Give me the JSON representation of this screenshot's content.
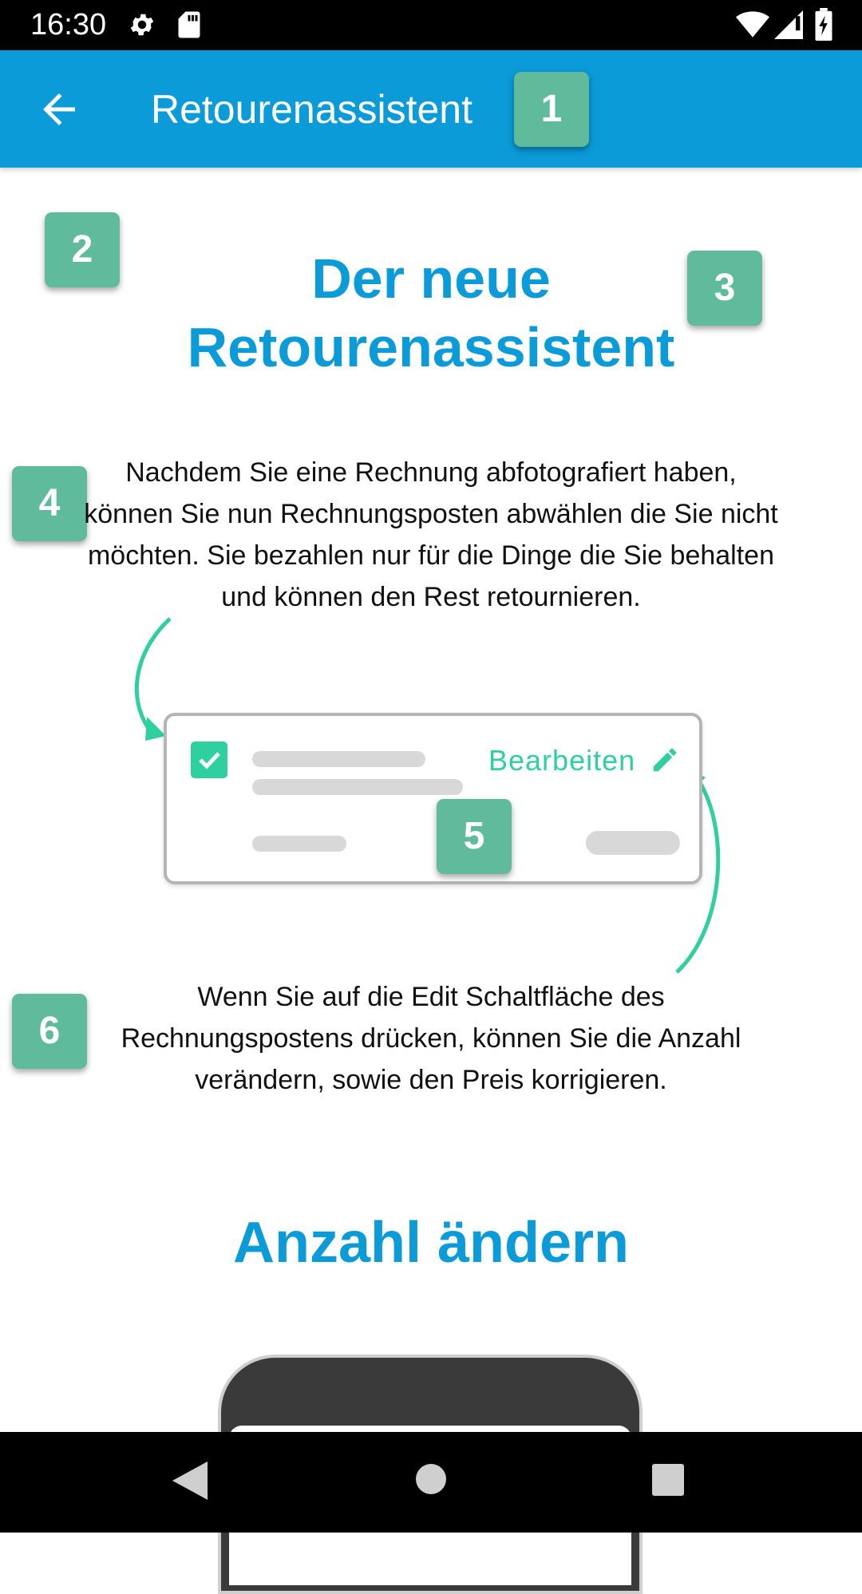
{
  "status_bar": {
    "time": "16:30",
    "icons": [
      "gear-icon",
      "sd-card-icon",
      "wifi-icon",
      "signal-icon",
      "battery-icon"
    ]
  },
  "app_bar": {
    "title": "Retourenassistent",
    "back_icon": "arrow-back-icon",
    "background_color": "#0a9bd8"
  },
  "badges": [
    "1",
    "2",
    "3",
    "4",
    "5",
    "6"
  ],
  "intro": {
    "heading_line1": "Der neue",
    "heading_line2": "Retourenassistent",
    "paragraph": "Nachdem Sie eine Rechnung abfotografiert haben, können Sie nun Rechnungsposten abwählen die Sie nicht möchten. Sie bezahlen nur für die Dinge die Sie behalten und können den Rest retournieren."
  },
  "illustration": {
    "checkbox_checked": true,
    "edit_label": "Bearbeiten",
    "edit_icon": "pencil-icon",
    "accent_color": "#2ed0a0"
  },
  "edit_info": {
    "paragraph": "Wenn Sie auf die Edit Schaltfläche des Rechnungspostens drücken, können Sie die Anzahl verändern, sowie den Preis korrigieren."
  },
  "quantity_section": {
    "heading": "Anzahl ändern"
  },
  "nav_bar": {
    "icons": [
      "nav-back-icon",
      "nav-home-icon",
      "nav-recents-icon"
    ]
  },
  "colors": {
    "badge": "#5fbb9b",
    "heading": "#0a9bd8"
  }
}
